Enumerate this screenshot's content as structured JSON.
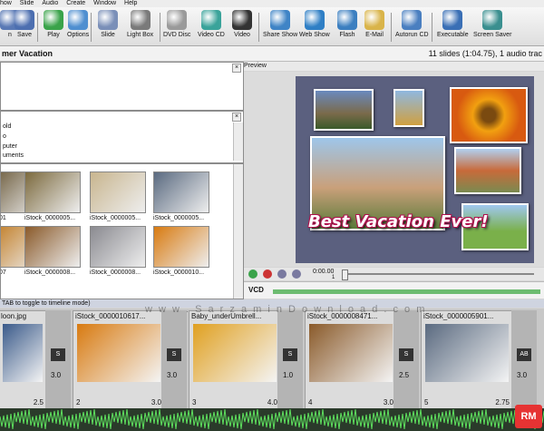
{
  "menu": [
    "how",
    "Slide",
    "Audio",
    "Create",
    "Window",
    "Help"
  ],
  "toolbar": {
    "buttons": [
      {
        "label": "n",
        "icon": "open-icon",
        "color": "#5a79b5"
      },
      {
        "label": "Save",
        "icon": "save-icon",
        "color": "#4d6fb0"
      },
      {
        "label": "Play",
        "icon": "play-icon",
        "color": "#3aa34a"
      },
      {
        "label": "Options",
        "icon": "options-icon",
        "color": "#4f8fd0"
      },
      {
        "label": "Slide",
        "icon": "slide-icon",
        "color": "#7a8fb8"
      },
      {
        "label": "Light Box",
        "icon": "lightbox-icon",
        "color": "#7a7a7a"
      },
      {
        "label": "DVD Disc",
        "icon": "dvd-icon",
        "color": "#9a9a9a"
      },
      {
        "label": "Video CD",
        "icon": "vcd-icon",
        "color": "#3aa39a"
      },
      {
        "label": "Video",
        "icon": "video-icon",
        "color": "#333333"
      },
      {
        "label": "Share Show",
        "icon": "share-icon",
        "color": "#3f84c6"
      },
      {
        "label": "Web Show",
        "icon": "web-icon",
        "color": "#2f7fc5"
      },
      {
        "label": "Flash",
        "icon": "flash-icon",
        "color": "#3c7fc0"
      },
      {
        "label": "E-Mail",
        "icon": "email-icon",
        "color": "#d9b44a"
      },
      {
        "label": "Autorun CD",
        "icon": "autorun-icon",
        "color": "#4a7fc0"
      },
      {
        "label": "Executable",
        "icon": "executable-icon",
        "color": "#3a6fb5"
      },
      {
        "label": "Screen Saver",
        "icon": "screensaver-icon",
        "color": "#3a8f8f"
      }
    ]
  },
  "project": {
    "title": "mer Vacation",
    "stats": "11 slides (1:04.75), 1 audio trac"
  },
  "tree": {
    "items": [
      "old",
      "o",
      "puter",
      "uments"
    ]
  },
  "thumbnails": [
    {
      "label": "01",
      "color": "#6b5a3a"
    },
    {
      "label": "iStock_0000005...",
      "color": "#7c6a3e"
    },
    {
      "label": "iStock_0000005...",
      "color": "#c8b58e"
    },
    {
      "label": "iStock_0000005...",
      "color": "#5a6a80"
    },
    {
      "label": "07",
      "color": "#c07a20"
    },
    {
      "label": "iStock_0000008...",
      "color": "#8a5a2a"
    },
    {
      "label": "iStock_0000008...",
      "color": "#8a8a90"
    },
    {
      "label": "iStock_0000010...",
      "color": "#d87a10"
    }
  ],
  "preview": {
    "header": "Preview",
    "banner": "Best Vacation Ever!",
    "time": "0:00.00",
    "time_sub": "1",
    "format": "VCD"
  },
  "timeline": {
    "hint": "TAB to toggle to timeline mode)",
    "slides": [
      {
        "name": "loon.jpg",
        "number": "",
        "duration": "2.5",
        "color": "#3a5a8a"
      },
      {
        "name": "iStock_0000010617...",
        "number": "2",
        "duration": "3.0",
        "color": "#d87a10"
      },
      {
        "name": "Baby_underUmbrell...",
        "number": "3",
        "duration": "4.0",
        "color": "#e0a020"
      },
      {
        "name": "iStock_0000008471...",
        "number": "4",
        "duration": "3.0",
        "color": "#8a5a2a"
      },
      {
        "name": "iStock_0000005901...",
        "number": "5",
        "duration": "2.75",
        "color": "#5a6a80"
      }
    ],
    "transitions": [
      {
        "label": "S",
        "duration": "3.0"
      },
      {
        "label": "S",
        "duration": "3.0"
      },
      {
        "label": "S",
        "duration": "1.0"
      },
      {
        "label": "S",
        "duration": "2.5"
      },
      {
        "label": "AB",
        "duration": "3.0"
      }
    ]
  },
  "watermark": "w w w . S a r z a m i n D o w n l o a d . c o m",
  "logo": "RM"
}
